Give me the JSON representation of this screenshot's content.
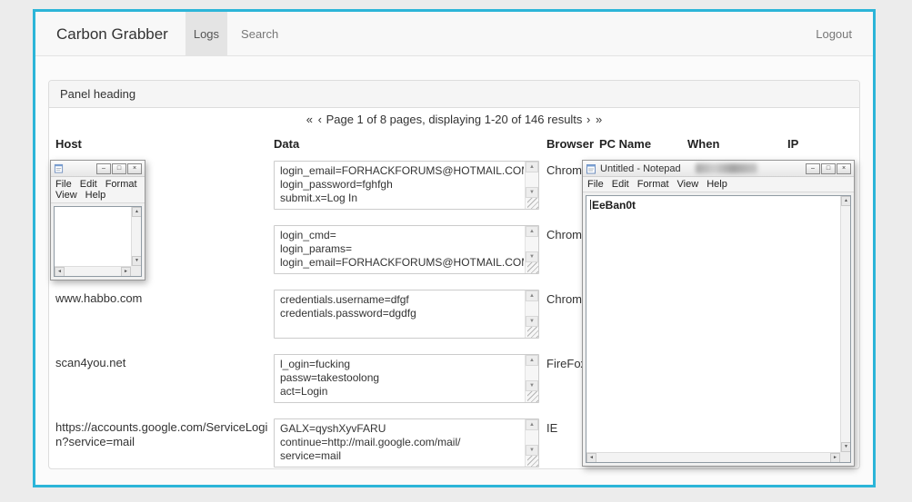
{
  "colors": {
    "accent": "#2cb5d8"
  },
  "navbar": {
    "brand": "Carbon Grabber",
    "tab_logs": "Logs",
    "tab_search": "Search",
    "logout": "Logout"
  },
  "panel": {
    "heading": "Panel heading",
    "pagination": {
      "first": "«",
      "prev": "‹",
      "summary": "Page 1 of 8 pages, displaying 1-20 of 146 results",
      "next": "›",
      "last": "»"
    },
    "columns": {
      "host": "Host",
      "data": "Data",
      "browser": "Browser",
      "pc_name": "PC Name",
      "when": "When",
      "ip": "IP"
    },
    "rows": [
      {
        "host": "",
        "data": "login_email=FORHACKFORUMS@HOTMAIL.COM\nlogin_password=fghfgh\nsubmit.x=Log In",
        "browser": "Chrome"
      },
      {
        "host": "",
        "data": "login_cmd=\nlogin_params=\nlogin_email=FORHACKFORUMS@HOTMAIL.COM",
        "browser": "Chrome"
      },
      {
        "host": "www.habbo.com",
        "data": "credentials.username=dfgf\ncredentials.password=dgdfg",
        "browser": "Chrome"
      },
      {
        "host": "scan4you.net",
        "data": "l_ogin=fucking\npassw=takestoolong\nact=Login",
        "browser": "FireFox"
      },
      {
        "host": "https://accounts.google.com/ServiceLogin?service=mail",
        "data": "GALX=qyshXyvFARU\ncontinue=http://mail.google.com/mail/\nservice=mail",
        "browser": "IE"
      }
    ]
  },
  "notepad_small": {
    "menu": [
      "File",
      "Edit",
      "Format",
      "View",
      "Help"
    ]
  },
  "notepad_large": {
    "title": "Untitled - Notepad",
    "menu": [
      "File",
      "Edit",
      "Format",
      "View",
      "Help"
    ],
    "content": "EeBan0t"
  },
  "icons": {
    "minimize": "–",
    "maximize": "□",
    "close": "×",
    "up": "▲",
    "down": "▼",
    "left": "◄",
    "right": "►"
  }
}
